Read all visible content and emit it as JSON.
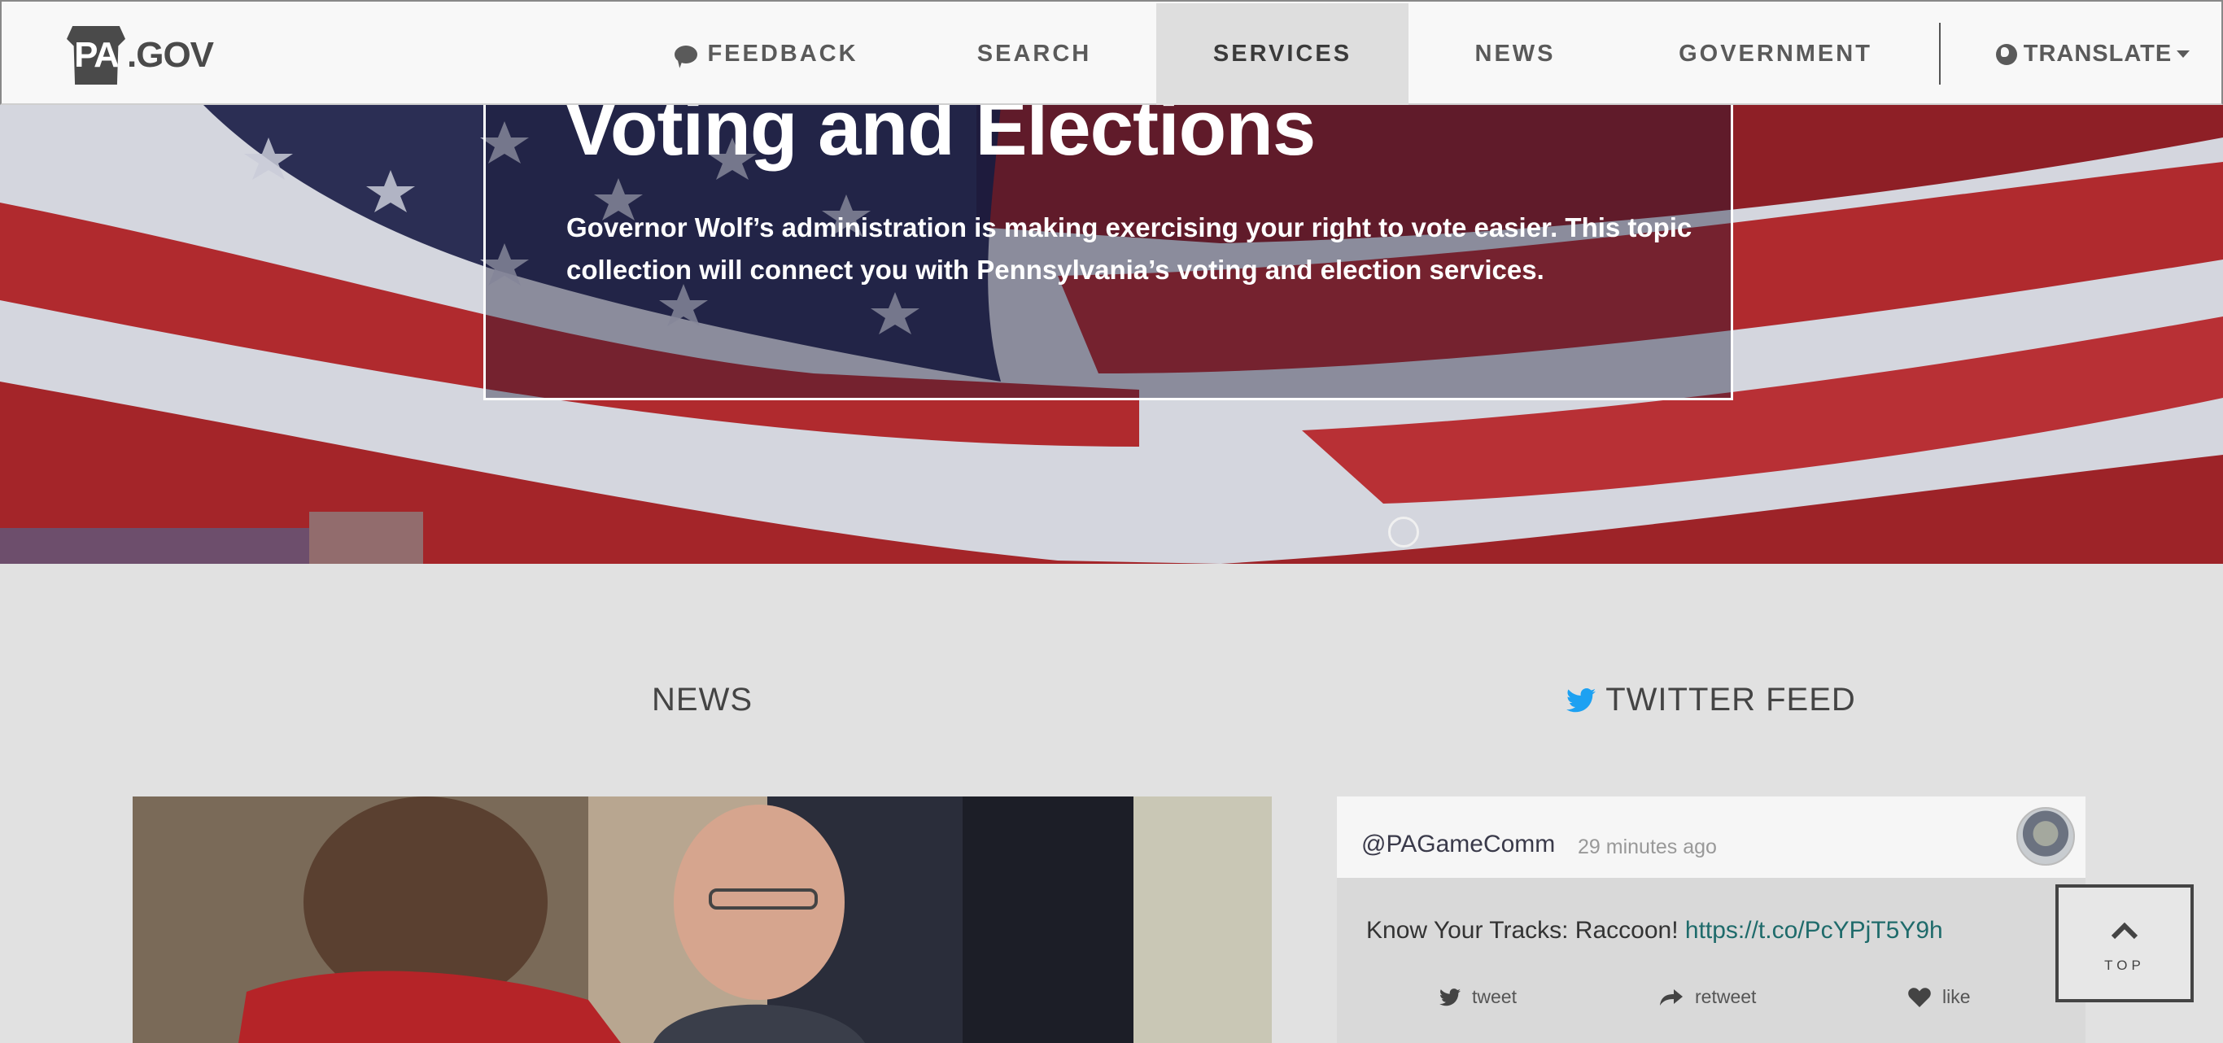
{
  "header": {
    "logo_pa": "PA",
    "logo_gov": ".GOV",
    "nav": {
      "feedback": "FEEDBACK",
      "search": "SEARCH",
      "services": "SERVICES",
      "news": "NEWS",
      "government": "GOVERNMENT",
      "translate": "TRANSLATE"
    }
  },
  "hero": {
    "title": "Voting and Elections",
    "description": "Governor Wolf’s administration is making exercising your right to vote easier. This topic collection will connect you with Pennsylvania’s voting and election services."
  },
  "news": {
    "heading": "NEWS"
  },
  "twitter": {
    "heading": "TWITTER FEED",
    "handle": "@PAGameComm",
    "time": "29 minutes ago",
    "text": "Know Your Tracks: Raccoon!",
    "link": "https://t.co/PcYPjT5Y9h",
    "actions": {
      "tweet": "tweet",
      "retweet": "retweet",
      "like": "like"
    }
  },
  "top_button": {
    "label": "TOP"
  },
  "colors": {
    "header_bg": "#f8f8f8",
    "active_tab": "#dedede",
    "page_bg": "#e1e1e1",
    "twitter_blue": "#1da1f2",
    "link": "#1f6b6b",
    "flag_red": "#b02a2e",
    "flag_navy": "#1c2048"
  }
}
